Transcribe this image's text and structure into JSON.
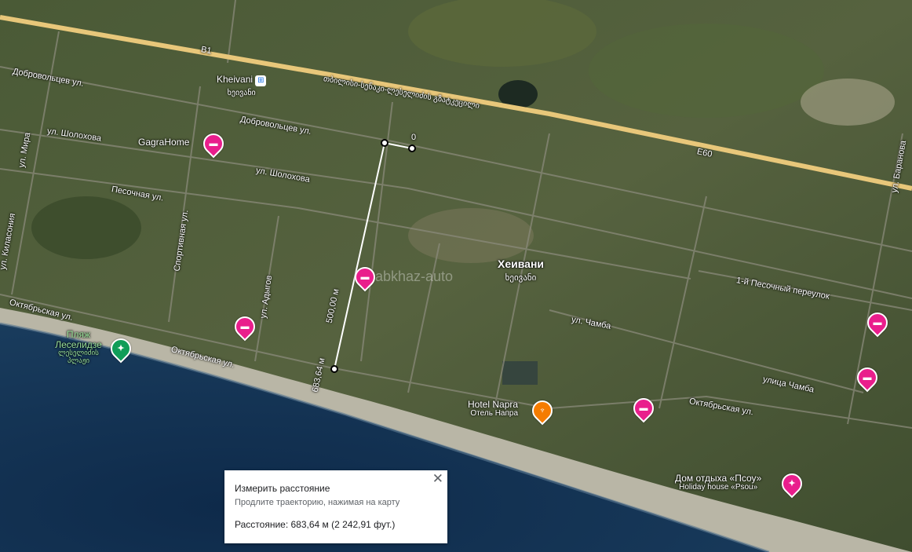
{
  "streets": {
    "b1": "B1",
    "highway_ge": "თბილისი-სენაკი-ლესელიძის გზატკეცილი",
    "e60": "E60",
    "dobrovoltsev_a": "Добровольцев ул.",
    "dobrovoltsev_b": "Добровольцев ул.",
    "sholokhova_a": "ул. Шолохова",
    "sholokhova_b": "ул. Шолохова",
    "mira": "ул. Мира",
    "pesochnaya": "Песочная ул.",
    "sportivnaya": "Спортивная ул.",
    "kilasonia": "ул. Киласония",
    "adygov": "ул. Адыгов",
    "oktyabrskaya_a": "Октябрьская ул.",
    "oktyabrskaya_b": "Октябрьская ул.",
    "oktyabrskaya_c": "Октябрьская ул.",
    "chamba_a": "ул. Чамба",
    "chamba_b": "улица Чамба",
    "pesochny_per": "1-й Песочный переулок",
    "baranova": "ул. Баранова"
  },
  "places": {
    "kheivani_station": "Kheivani",
    "kheivani_station_ge": "ხეივანი",
    "gagrahome": "GagraHome",
    "town": "Хеивани",
    "town_ge": "ხეივანი",
    "beach": "Пляж Леселидзе",
    "beach_ge": "ლესელიძის პლაჟი",
    "hotel_en": "Hotel Napra",
    "hotel_ru": "Отель Напра",
    "psou_ru": "Дом отдыха «Псоу»",
    "psou_en": "Holiday house «Psou»",
    "watermark": "abkhaz-auto"
  },
  "measure": {
    "label_start": "0",
    "label_mid": "500,00 м",
    "label_end": "683,64 м"
  },
  "panel": {
    "title": "Измерить расстояние",
    "hint": "Продлите траекторию, нажимая на карту",
    "distance": "Расстояние: 683,64 м (2 242,91 фут.)",
    "close": "✕"
  },
  "colors": {
    "highway": "#e8c77a",
    "sea": "#0e2a4a",
    "hotel_pin": "#e91e8c",
    "beach_pin": "#0f9d58",
    "restaurant_pin": "#f57c00"
  }
}
